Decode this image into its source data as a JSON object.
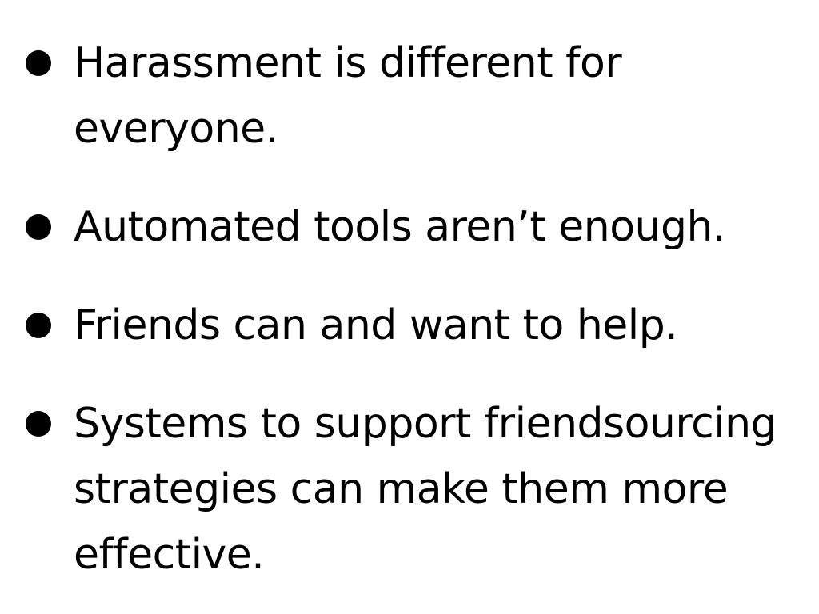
{
  "bullets": [
    {
      "text": "Harassment is different for everyone."
    },
    {
      "text": "Automated tools aren’t enough."
    },
    {
      "text": "Friends can and want to help."
    },
    {
      "text": "Systems to support friendsourcing strategies can make them more effective."
    }
  ]
}
